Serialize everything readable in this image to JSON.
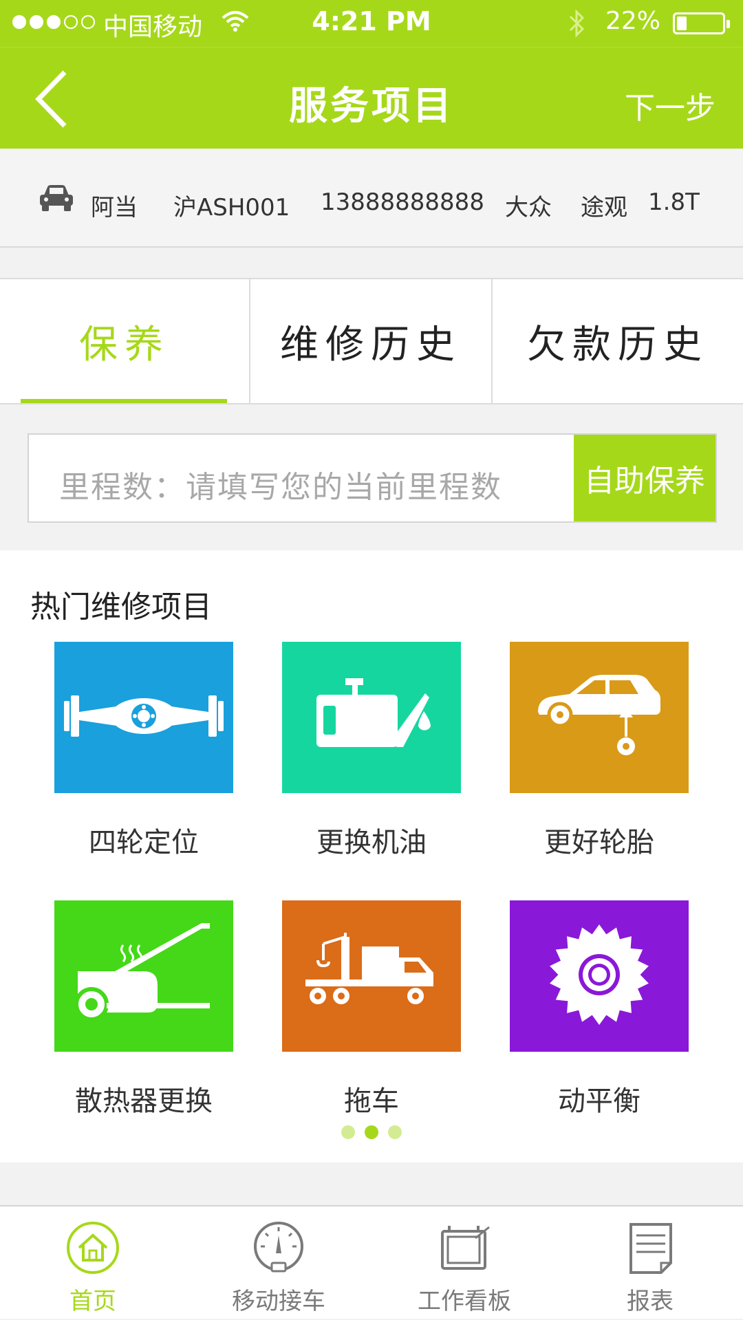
{
  "status_bar": {
    "carrier": "中国移动",
    "time": "4:21 PM",
    "battery_percent": "22%",
    "signal_bars_filled": 3,
    "signal_bars_total": 5
  },
  "nav": {
    "title": "服务项目",
    "next_label": "下一步",
    "back_icon": "chevron-left-icon"
  },
  "car_info": {
    "owner": "阿当",
    "plate": "沪ASH001",
    "phone": "13888888888",
    "brand": "大众",
    "model": "途观",
    "engine": "1.8T"
  },
  "tabs": [
    {
      "label": "保养",
      "active": true
    },
    {
      "label": "维修历史",
      "active": false
    },
    {
      "label": "欠款历史",
      "active": false
    }
  ],
  "mileage": {
    "placeholder": "里程数：请填写您的当前里程数",
    "button_label": "自助保养"
  },
  "hot_section": {
    "title": "热门维修项目",
    "items": [
      {
        "label": "四轮定位",
        "icon": "axle-icon",
        "color": "#1aa0dc"
      },
      {
        "label": "更换机油",
        "icon": "oil-can-icon",
        "color": "#16d6a0"
      },
      {
        "label": "更好轮胎",
        "icon": "car-tire-icon",
        "color": "#d99a18"
      },
      {
        "label": "散热器更换",
        "icon": "radiator-icon",
        "color": "#44d818"
      },
      {
        "label": "拖车",
        "icon": "tow-truck-icon",
        "color": "#db6c18"
      },
      {
        "label": "动平衡",
        "icon": "turbine-icon",
        "color": "#8a18d8"
      }
    ],
    "page_count": 3,
    "active_page": 2
  },
  "tab_bar": [
    {
      "label": "首页",
      "icon": "home-icon",
      "active": true
    },
    {
      "label": "移动接车",
      "icon": "gauge-icon",
      "active": false
    },
    {
      "label": "工作看板",
      "icon": "board-icon",
      "active": false
    },
    {
      "label": "报表",
      "icon": "report-icon",
      "active": false
    }
  ],
  "colors": {
    "accent": "#a6d81a",
    "accent_light": "#d3ec93"
  }
}
